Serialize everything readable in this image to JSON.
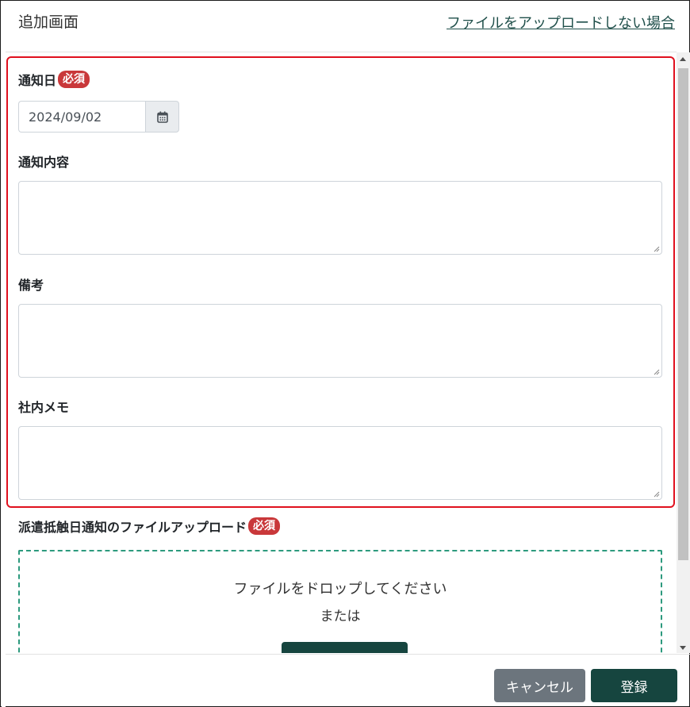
{
  "header": {
    "title": "追加画面",
    "no_upload_link": "ファイルをアップロードしない場合"
  },
  "form": {
    "notice_date": {
      "label": "通知日",
      "required_badge": "必須",
      "value": "2024/09/02",
      "icon": "calendar-icon"
    },
    "notice_content": {
      "label": "通知内容",
      "value": ""
    },
    "remarks": {
      "label": "備考",
      "value": ""
    },
    "internal_memo": {
      "label": "社内メモ",
      "value": ""
    }
  },
  "upload": {
    "label": "派遣抵触日通知のファイルアップロード",
    "required_badge": "必須",
    "drop_text": "ファイルをドロップしてください",
    "or_text": "または"
  },
  "footer": {
    "cancel_label": "キャンセル",
    "submit_label": "登録"
  },
  "colors": {
    "accent": "#16453f",
    "required": "#c9383a",
    "highlight": "#e0101e",
    "dropzone_border": "#2d9a7e"
  }
}
